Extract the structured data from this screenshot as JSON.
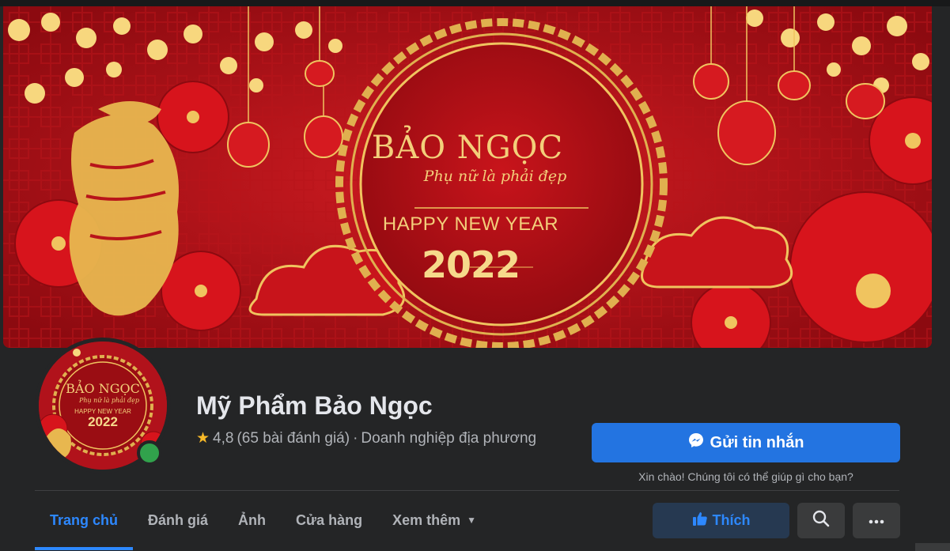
{
  "cover": {
    "brand": "BẢO NGỌC",
    "slogan": "Phụ nữ là phải đẹp",
    "greeting": "HAPPY NEW YEAR",
    "year": "2022"
  },
  "avatar": {
    "brand": "BẢO NGỌC",
    "slogan": "Phụ nữ là phải đẹp",
    "greeting": "HAPPY NEW YEAR",
    "year": "2022"
  },
  "page": {
    "name": "Mỹ Phẩm Bảo Ngọc",
    "rating": "4,8",
    "reviews": "(65 bài đánh giá)",
    "separator": "·",
    "category": "Doanh nghiệp địa phương"
  },
  "actions": {
    "message_label": "Gửi tin nhắn",
    "greeting_text": "Xin chào! Chúng tôi có thể giúp gì cho bạn?",
    "like_label": "Thích"
  },
  "tabs": [
    {
      "label": "Trang chủ",
      "active": true
    },
    {
      "label": "Đánh giá",
      "active": false
    },
    {
      "label": "Ảnh",
      "active": false
    },
    {
      "label": "Cửa hàng",
      "active": false
    },
    {
      "label": "Xem thêm",
      "active": false
    }
  ],
  "icons": {
    "star": "star-icon",
    "messenger": "messenger-icon",
    "like": "thumbs-up-icon",
    "search": "search-icon",
    "more": "more-icon",
    "dropdown": "chevron-down-icon"
  },
  "colors": {
    "background": "#242526",
    "accent": "#2d88ff",
    "message_button": "#2374e1",
    "cover_red": "#b1121b",
    "gold": "#f3cf7a",
    "online": "#31a24c"
  }
}
